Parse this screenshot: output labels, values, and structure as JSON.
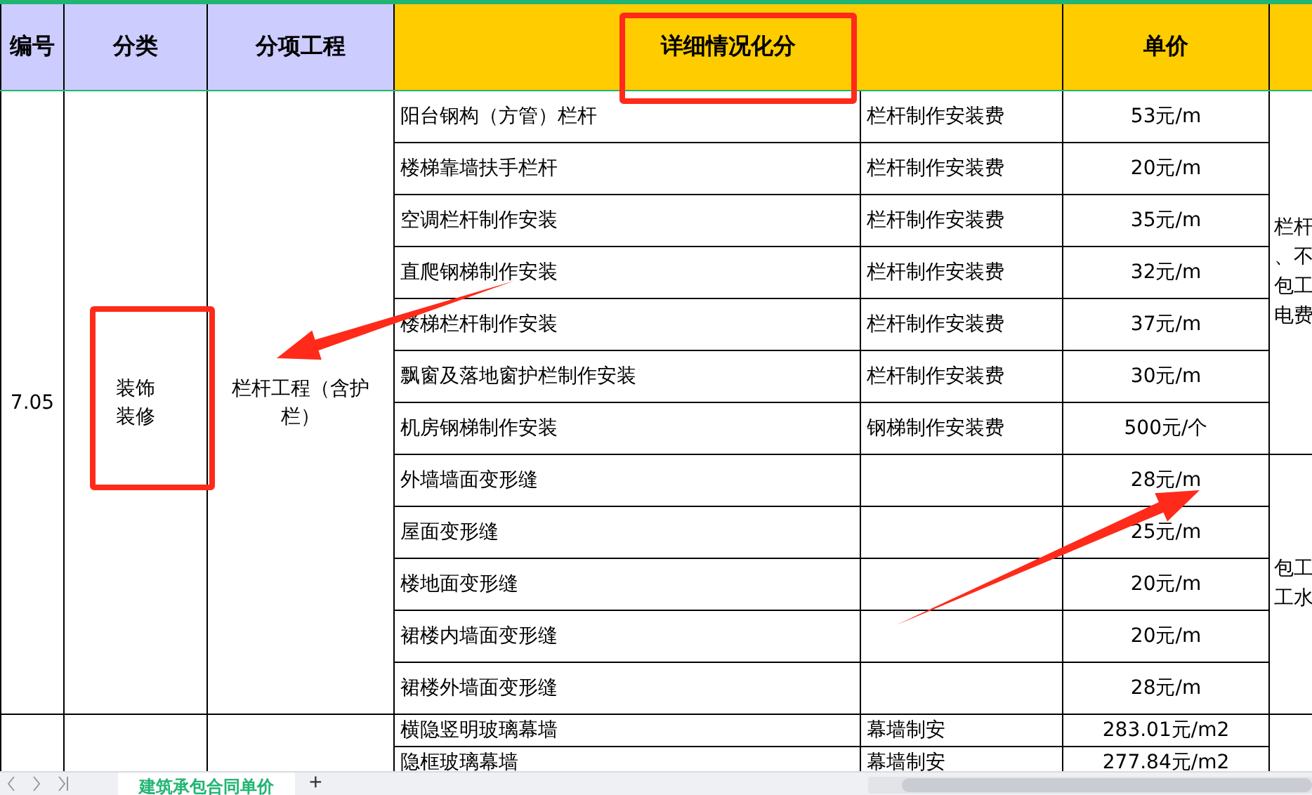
{
  "header": [
    {
      "label": "编号",
      "kind": "key"
    },
    {
      "label": "分类",
      "kind": "key"
    },
    {
      "label": "分项工程",
      "kind": "key"
    },
    {
      "label": "详细情况化分",
      "kind": "main"
    },
    {
      "label": "单价",
      "kind": "main"
    },
    {
      "kind": "main"
    }
  ],
  "groups": [
    {
      "number": "7.05",
      "category": "装饰装修",
      "item": "栏杆工程（含护栏）",
      "blocks": [
        {
          "note_lines": [
            "栏杆",
            "、不",
            "包工",
            "电费"
          ],
          "rows": [
            {
              "detail": "阳台钢构（方管）栏杆",
              "fee": "栏杆制作安装费",
              "price": "53元/m"
            },
            {
              "detail": "楼梯靠墙扶手栏杆",
              "fee": "栏杆制作安装费",
              "price": "20元/m"
            },
            {
              "detail": "空调栏杆制作安装",
              "fee": "栏杆制作安装费",
              "price": "35元/m"
            },
            {
              "detail": "直爬钢梯制作安装",
              "fee": "栏杆制作安装费",
              "price": "32元/m"
            },
            {
              "detail": "楼梯栏杆制作安装",
              "fee": "栏杆制作安装费",
              "price": "37元/m"
            },
            {
              "detail": "飘窗及落地窗护栏制作安装",
              "fee": "栏杆制作安装费",
              "price": "30元/m"
            },
            {
              "detail": "机房钢梯制作安装",
              "fee": "钢梯制作安装费",
              "price": "500元/个"
            }
          ]
        },
        {
          "note_lines": [
            "包工",
            "工水"
          ],
          "rows": [
            {
              "detail": "外墙墙面变形缝",
              "price": "28元/m"
            },
            {
              "detail": "屋面变形缝",
              "price": "25元/m"
            },
            {
              "detail": "楼地面变形缝",
              "price": "20元/m"
            },
            {
              "detail": "裙楼内墙面变形缝",
              "price": "20元/m"
            },
            {
              "detail": "裙楼外墙面变形缝",
              "price": "28元/m"
            }
          ]
        }
      ]
    },
    {
      "blocks": [
        {
          "rows": [
            {
              "detail": "横隐竖明玻璃幕墙",
              "fee": "幕墙制安",
              "price": "283.01元/m2",
              "kind": "short"
            },
            {
              "detail": "隐框玻璃幕墙",
              "fee": "幕墙制安",
              "price": "277.84元/m2",
              "kind": "short"
            }
          ]
        }
      ]
    }
  ],
  "annotations": [
    {
      "kind": "box"
    },
    {
      "kind": "box"
    },
    {
      "kind": "arrow"
    },
    {
      "kind": "arrow"
    }
  ],
  "sheet_tabs": [
    {
      "label": "建筑承包合同单价",
      "selected": true
    }
  ],
  "add_sheet": "+"
}
